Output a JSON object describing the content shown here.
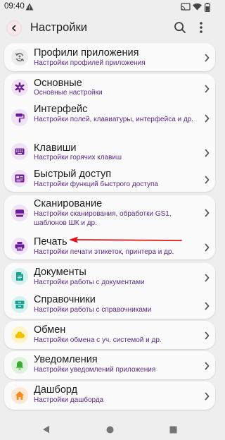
{
  "status": {
    "time": "09:40"
  },
  "header": {
    "title": "Настройки"
  },
  "items": [
    {
      "title": "Профили приложения",
      "subtitle": "Настройки профилей приложения"
    },
    {
      "title": "Основные",
      "subtitle": "Основные настройки"
    },
    {
      "title": "Интерфейс",
      "subtitle": "Настройки полей, клавиатуры, интерфейса и др."
    },
    {
      "title": "Клавиши",
      "subtitle": "Настройки горячих клавиш"
    },
    {
      "title": "Быстрый доступ",
      "subtitle": "Настройки функций быстрого доступа"
    },
    {
      "title": "Сканирование",
      "subtitle": "Настройки сканирования, обработки GS1, шаблонов ШК и др."
    },
    {
      "title": "Печать",
      "subtitle": "Настройки печати этикеток, принтера и др."
    },
    {
      "title": "Документы",
      "subtitle": "Настройки работы с документами"
    },
    {
      "title": "Справочники",
      "subtitle": "Настройки работы с справочниками"
    },
    {
      "title": "Обмен",
      "subtitle": "Настройки обмена с уч. системой и др."
    },
    {
      "title": "Уведомления",
      "subtitle": "Настройки уведомлений приложения"
    },
    {
      "title": "Дашборд",
      "subtitle": "Настройки дашборда"
    }
  ],
  "colors": {
    "accent_purple": "#6a1b9a",
    "icon_bg_purple": "#f1e3f6",
    "icon_bg_teal": "#d7f1ef",
    "icon_bg_yellow": "#fdf5c8",
    "icon_bg_green": "#dff2dc",
    "icon_bg_orange": "#fde7d5",
    "annotation_arrow": "#e4121b"
  }
}
